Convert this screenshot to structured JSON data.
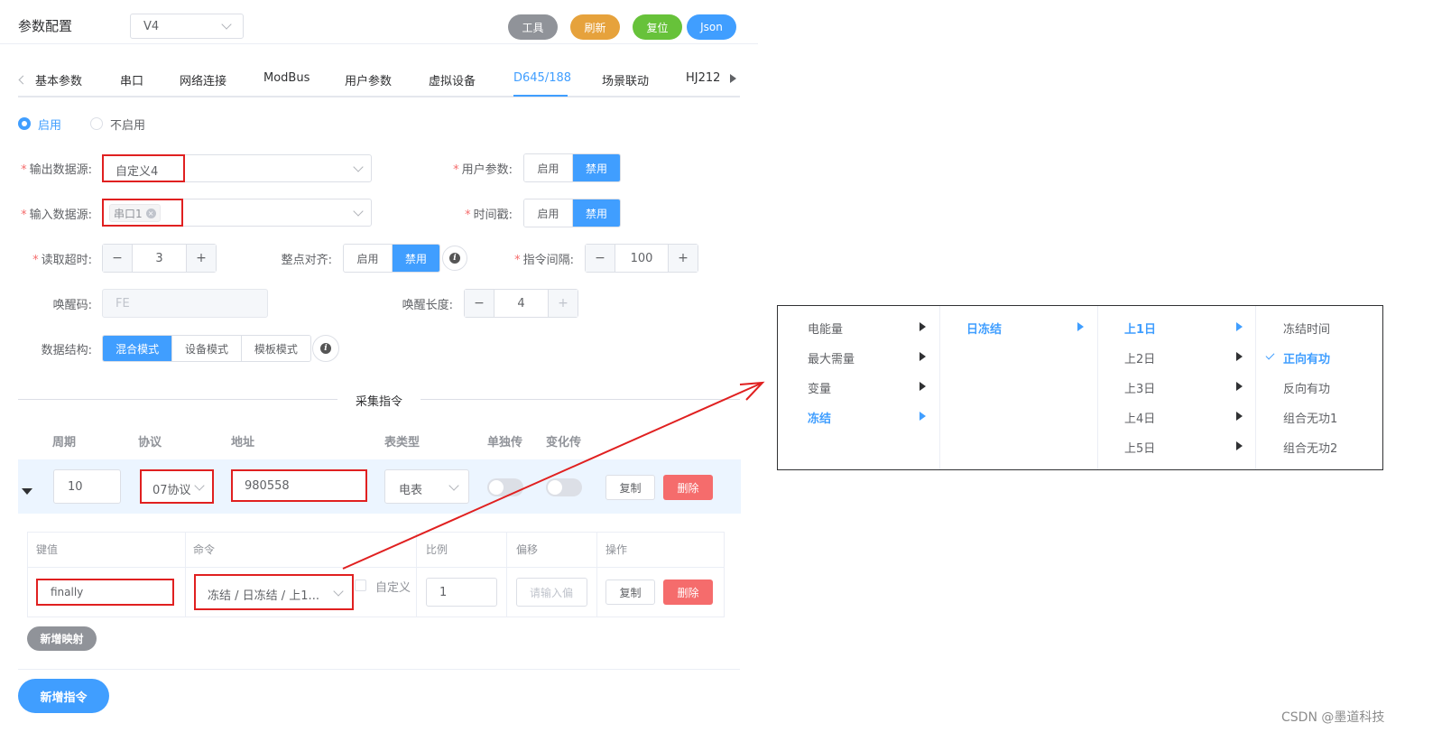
{
  "header": {
    "title": "参数配置",
    "version": "V4",
    "buttons": [
      {
        "label": "工具",
        "color": "#909399"
      },
      {
        "label": "刷新",
        "color": "#e6a23c"
      },
      {
        "label": "复位",
        "color": "#67c23a"
      },
      {
        "label": "Json",
        "color": "#409eff"
      }
    ]
  },
  "tabs": [
    "基本参数",
    "串口",
    "网络连接",
    "ModBus",
    "用户参数",
    "虚拟设备",
    "D645/188",
    "场景联动",
    "HJ212"
  ],
  "active_tab": "D645/188",
  "enable_radio": {
    "on": "启用",
    "off": "不启用"
  },
  "form": {
    "output_source_label": "输出数据源:",
    "output_source_value": "自定义4",
    "input_source_label": "输入数据源:",
    "input_source_tag": "串口1",
    "user_param_label": "用户参数:",
    "timestamp_label": "时间戳:",
    "enable": "启用",
    "disable": "禁用",
    "read_timeout_label": "读取超时:",
    "read_timeout_value": "3",
    "align_label": "整点对齐:",
    "cmd_interval_label": "指令间隔:",
    "cmd_interval_value": "100",
    "wake_code_label": "唤醒码:",
    "wake_code_placeholder": "FE",
    "wake_len_label": "唤醒长度:",
    "wake_len_value": "4",
    "data_struct_label": "数据结构:",
    "data_struct_options": [
      "混合模式",
      "设备模式",
      "模板模式"
    ]
  },
  "collect": {
    "divider": "采集指令",
    "headers": [
      "周期",
      "协议",
      "地址",
      "表类型",
      "单独传",
      "变化传"
    ],
    "row": {
      "period": "10",
      "protocol": "07协议",
      "address": "980558",
      "meter": "电表",
      "copy": "复制",
      "delete": "删除"
    }
  },
  "mapping": {
    "headers": [
      "键值",
      "命令",
      "比例",
      "偏移",
      "操作"
    ],
    "row": {
      "key": "finally",
      "command": "冻结 / 日冻结 / 上1...",
      "custom": "自定义",
      "ratio": "1",
      "offset_placeholder": "请输入偏",
      "copy": "复制",
      "delete": "删除"
    },
    "add_mapping": "新增映射"
  },
  "add_command": "新增指令",
  "cascader": {
    "col1": [
      "电能量",
      "最大需量",
      "变量",
      "冻结"
    ],
    "col1_active": "冻结",
    "col2": [
      "日冻结"
    ],
    "col2_active": "日冻结",
    "col3": [
      "上1日",
      "上2日",
      "上3日",
      "上4日",
      "上5日"
    ],
    "col3_active": "上1日",
    "col4": [
      "冻结时间",
      "正向有功",
      "反向有功",
      "组合无功1",
      "组合无功2"
    ],
    "col4_active": "正向有功"
  },
  "watermark": "CSDN @墨道科技"
}
